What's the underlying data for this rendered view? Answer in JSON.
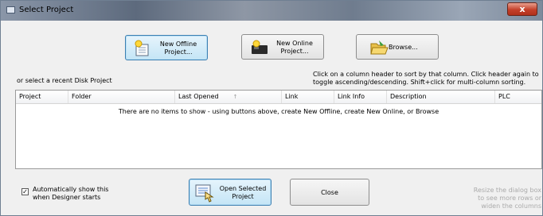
{
  "window": {
    "title": "Select Project",
    "close_label": "x"
  },
  "toolbar": {
    "new_offline_label": "New Offline\nProject...",
    "new_online_label": "New Online\nProject...",
    "browse_label": "Browse..."
  },
  "recent_label": "or select a recent Disk Project",
  "sort_hint": "Click on a column header to sort by that column. Click header again to\ntoggle ascending/descending. Shift+click for multi-column sorting.",
  "table": {
    "columns": [
      "Project",
      "Folder",
      "Last Opened",
      "Link",
      "Link Info",
      "Description",
      "PLC"
    ],
    "empty_message": "There are no items to show - using buttons above, create New Offline, create New Online, or Browse"
  },
  "footer": {
    "auto_show_label": "Automatically show this\nwhen Designer starts",
    "auto_show_checked": "✓",
    "open_label": "Open Selected\nProject",
    "close_label": "Close",
    "resize_hint": "Resize the dialog box\nto see more rows or\nwiden the columns"
  },
  "colors": {
    "accent": "#3c7fb1",
    "title_bar": "#6f7c8e",
    "close": "#c4402a"
  }
}
